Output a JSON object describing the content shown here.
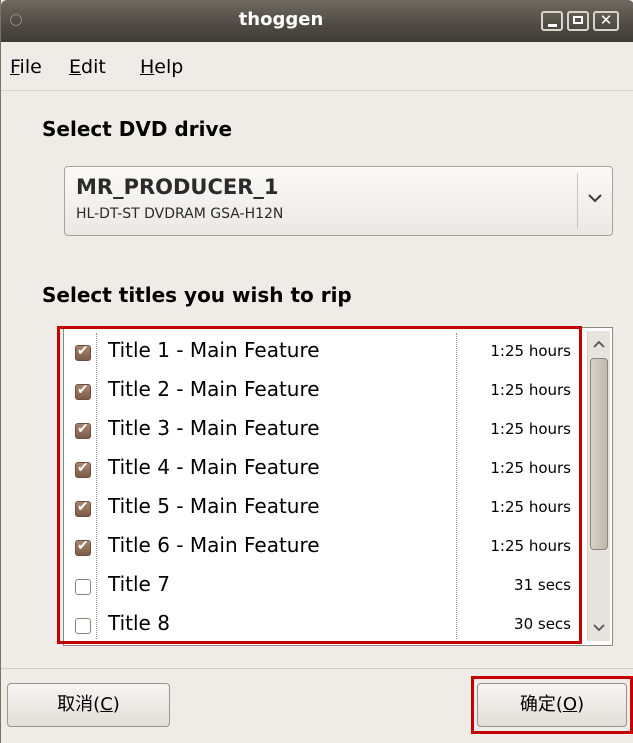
{
  "window": {
    "title": "thoggen"
  },
  "menu": [
    {
      "mnemonic": "F",
      "rest": "ile"
    },
    {
      "mnemonic": "E",
      "rest": "dit"
    },
    {
      "mnemonic": "H",
      "rest": "elp"
    }
  ],
  "drive_section": {
    "heading": "Select DVD drive",
    "selected_name": "MR_PRODUCER_1",
    "selected_device": "HL-DT-ST DVDRAM GSA-H12N"
  },
  "titles_section": {
    "heading": "Select titles you wish to rip",
    "rows": [
      {
        "name": "Title 1 - Main Feature",
        "duration": "1:25  hours",
        "checked": true
      },
      {
        "name": "Title 2 - Main Feature",
        "duration": "1:25  hours",
        "checked": true
      },
      {
        "name": "Title 3 - Main Feature",
        "duration": "1:25  hours",
        "checked": true
      },
      {
        "name": "Title 4 - Main Feature",
        "duration": "1:25  hours",
        "checked": true
      },
      {
        "name": "Title 5 - Main Feature",
        "duration": "1:25  hours",
        "checked": true
      },
      {
        "name": "Title 6 - Main Feature",
        "duration": "1:25  hours",
        "checked": true
      },
      {
        "name": "Title 7",
        "duration": "31  secs",
        "checked": false
      },
      {
        "name": "Title 8",
        "duration": "30  secs",
        "checked": false
      }
    ]
  },
  "buttons": {
    "cancel": {
      "prefix": "取消(",
      "mnemonic": "C",
      "suffix": ")"
    },
    "ok": {
      "prefix": "确定(",
      "mnemonic": "O",
      "suffix": ")"
    }
  },
  "colors": {
    "highlight_box": "#c40000",
    "titlebar": "#4f4b44",
    "window_bg": "#efebe7"
  }
}
